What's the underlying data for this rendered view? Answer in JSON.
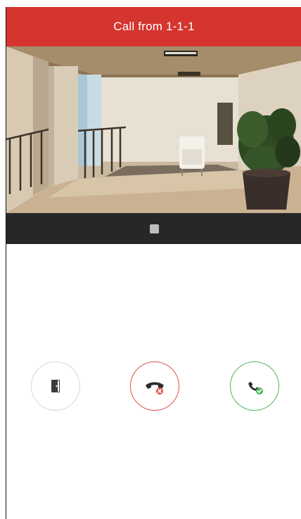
{
  "header": {
    "title": "Call from 1-1-1"
  },
  "colors": {
    "header_bg": "#d4352f",
    "control_bar_bg": "#272727",
    "hangup_red": "#e0504c",
    "answer_green": "#4fb65a",
    "unlock_gray": "#d7d7d7",
    "door_icon": "#3a3a3a"
  },
  "video": {
    "icon": "camera-feed"
  },
  "controls": {
    "stop_icon": "stop-square-icon"
  },
  "actions": [
    {
      "id": "unlock",
      "icon": "door-icon"
    },
    {
      "id": "hangup",
      "icon": "hangup-phone-icon"
    },
    {
      "id": "answer",
      "icon": "answer-phone-icon"
    }
  ]
}
